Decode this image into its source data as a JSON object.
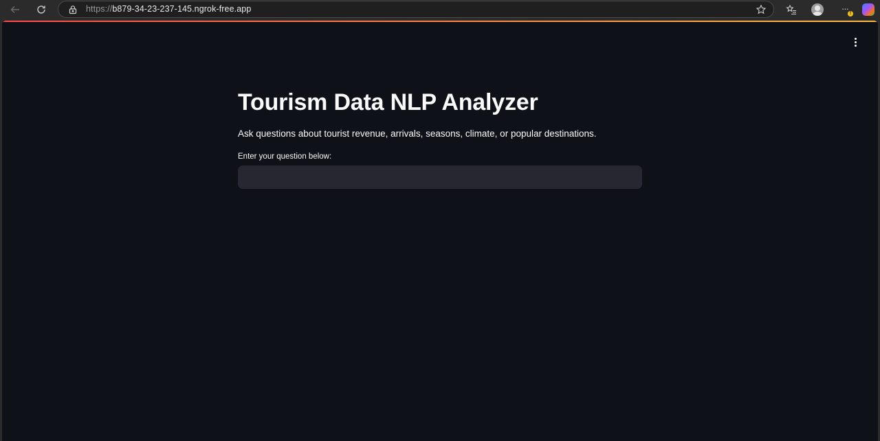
{
  "browser": {
    "url_scheme": "https://",
    "url_host": "b879-34-23-237-145.ngrok-free.app",
    "more_label": "···"
  },
  "app": {
    "title": "Tourism Data NLP Analyzer",
    "subtitle": "Ask questions about tourist revenue, arrivals, seasons, climate, or popular destinations.",
    "input_label": "Enter your question below:",
    "input_value": "",
    "accent_colors": [
      "#ff4b4b",
      "#ffbd45"
    ],
    "background": "#0e1117"
  },
  "icons": {
    "back": "back-arrow-icon",
    "reload": "reload-icon",
    "site_info": "lock-icon",
    "favorite": "star-icon",
    "favorites": "favorites-icon",
    "profile": "profile-icon",
    "more": "more-dots-icon",
    "copilot": "copilot-icon",
    "app_menu": "vertical-dots-icon"
  }
}
